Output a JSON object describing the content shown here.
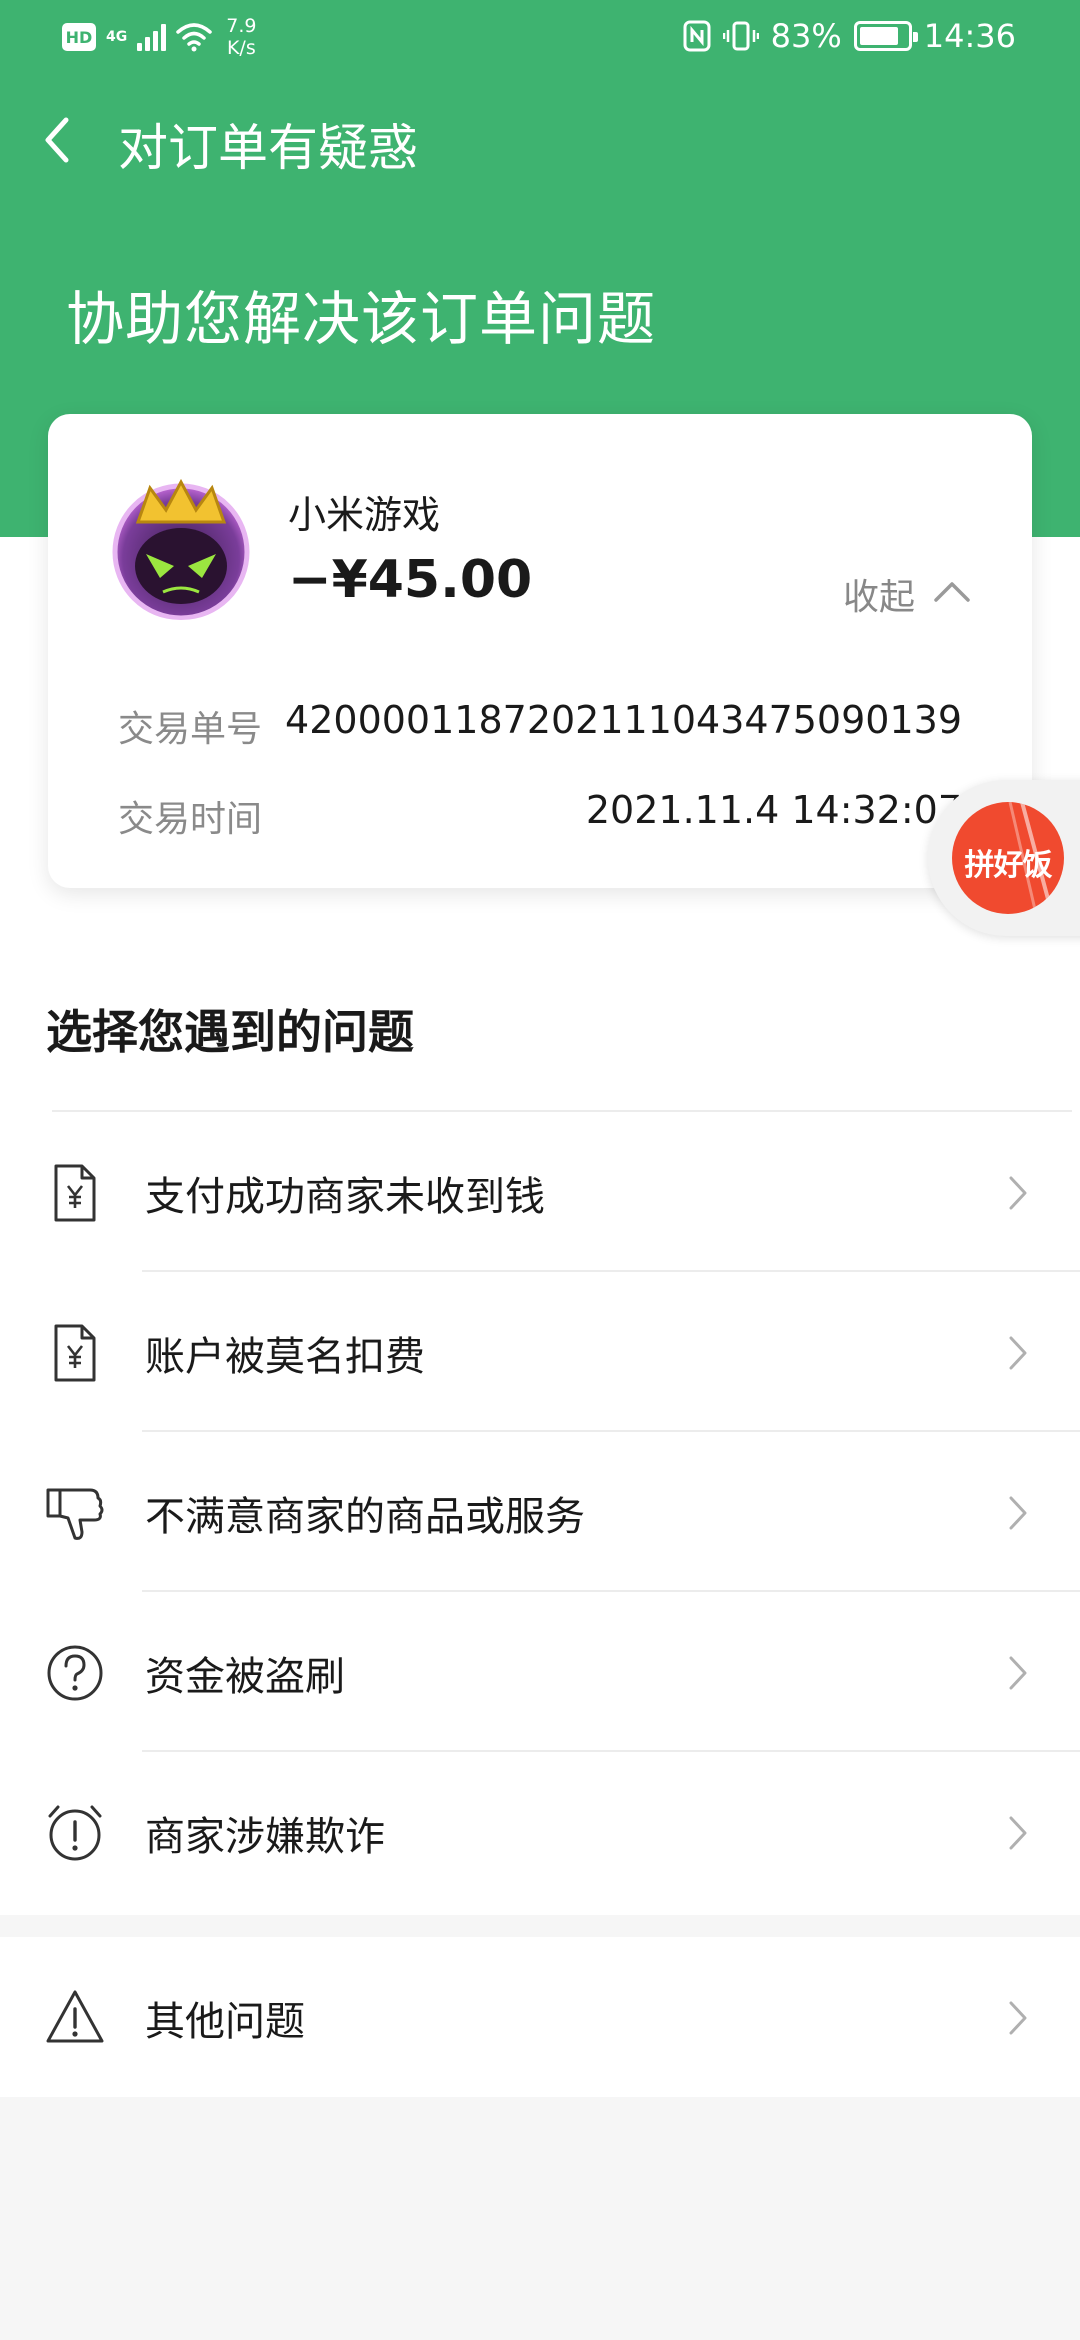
{
  "status_bar": {
    "hd": "HD",
    "signal": "4G",
    "speed_value": "7.9",
    "speed_unit": "K/s",
    "battery_text": "83%",
    "battery_level": 0.83,
    "time": "14:36"
  },
  "header": {
    "title": "对订单有疑惑",
    "headline": "协助您解决该订单问题"
  },
  "order": {
    "merchant": "小米游戏",
    "amount": "−¥45.00",
    "collapse_label": "收起",
    "trade_no_label": "交易单号",
    "trade_no": "4200001187202111043475090139",
    "trade_time_label": "交易时间",
    "trade_time": "2021.11.4 14:32:07"
  },
  "float_badge": {
    "text": "拼好饭"
  },
  "section": {
    "title": "选择您遇到的问题"
  },
  "issues": [
    {
      "label": "支付成功商家未收到钱",
      "icon": "yuan-document-icon"
    },
    {
      "label": "账户被莫名扣费",
      "icon": "yuan-document-icon"
    },
    {
      "label": "不满意商家的商品或服务",
      "icon": "thumbs-down-icon"
    },
    {
      "label": "资金被盗刷",
      "icon": "question-circle-icon"
    },
    {
      "label": "商家涉嫌欺诈",
      "icon": "alarm-clock-exclamation-icon"
    }
  ],
  "other_issue": {
    "label": "其他问题",
    "icon": "warning-triangle-icon"
  },
  "colors": {
    "brand_green": "#3eb370",
    "badge_red": "#f04a2f"
  }
}
